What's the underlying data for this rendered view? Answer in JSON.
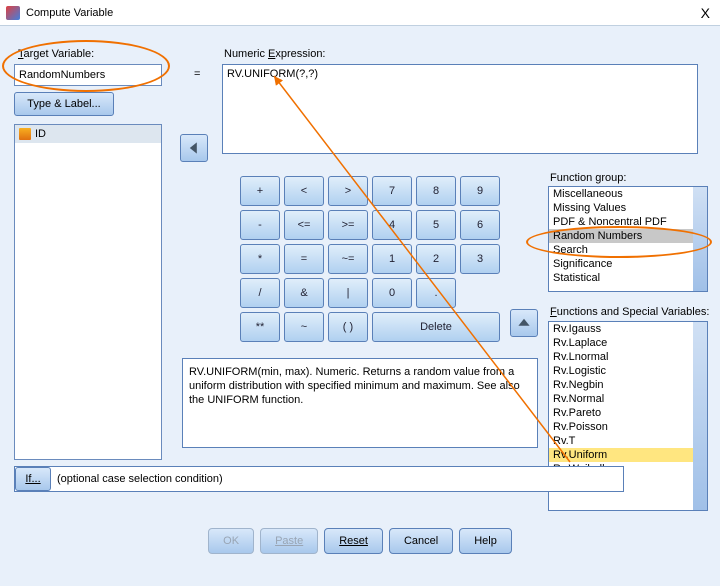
{
  "window": {
    "title": "Compute Variable",
    "close": "X"
  },
  "target": {
    "label": "Target Variable:",
    "value": "RandomNumbers",
    "type_label_btn": "Type & Label..."
  },
  "eq": "=",
  "numexp": {
    "label": "Numeric Expression:",
    "value": "RV.UNIFORM(?,?)"
  },
  "varlist": {
    "items": [
      "ID"
    ]
  },
  "keypad": {
    "rows": [
      [
        "+",
        "<",
        ">",
        "7",
        "8",
        "9"
      ],
      [
        "-",
        "<=",
        ">=",
        "4",
        "5",
        "6"
      ],
      [
        "*",
        "=",
        "~=",
        "1",
        "2",
        "3"
      ],
      [
        "/",
        "&",
        "|",
        "0",
        ".",
        ""
      ],
      [
        "**",
        "~",
        "( )",
        "Delete",
        "",
        ""
      ]
    ],
    "delete": "Delete"
  },
  "description": "RV.UNIFORM(min, max). Numeric. Returns a random value from a uniform distribution with specified minimum and maximum. See also the UNIFORM function.",
  "function_group": {
    "label": "Function group:",
    "items": [
      "Miscellaneous",
      "Missing Values",
      "PDF & Noncentral PDF",
      "Random Numbers",
      "Search",
      "Significance",
      "Statistical"
    ],
    "selected": "Random Numbers"
  },
  "functions": {
    "label": "Functions and Special Variables:",
    "items": [
      "Rv.Igauss",
      "Rv.Laplace",
      "Rv.Lnormal",
      "Rv.Logistic",
      "Rv.Negbin",
      "Rv.Normal",
      "Rv.Pareto",
      "Rv.Poisson",
      "Rv.T",
      "Rv.Uniform",
      "Rv.Weibull"
    ],
    "selected": "Rv.Uniform"
  },
  "ifrow": {
    "btn": "If...",
    "text": "(optional case selection condition)"
  },
  "buttons": {
    "ok": "OK",
    "paste": "Paste",
    "reset": "Reset",
    "cancel": "Cancel",
    "help": "Help"
  }
}
